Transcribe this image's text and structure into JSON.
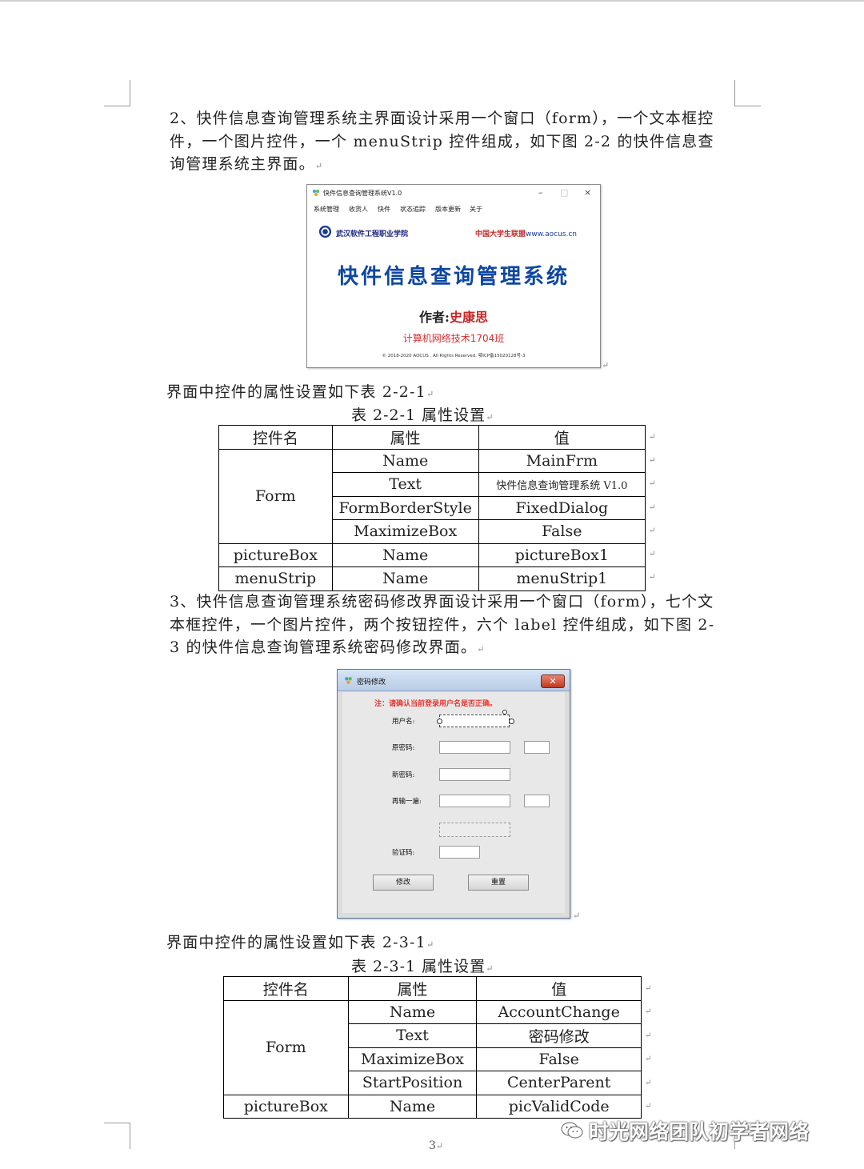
{
  "paragraphs": {
    "p1_line1": "2、快件信息查询管理系统主界面设计采用一个窗口（form），一个文本框控",
    "p1_line2": "件，一个图片控件，一个 menuStrip 控件组成，如下图 2-2 的快件信息查",
    "p1_line3": "询管理系统主界面。",
    "p2": "界面中控件的属性设置如下表 2-2-1",
    "p3_line1": "3、快件信息查询管理系统密码修改界面设计采用一个窗口（form），七个文",
    "p3_line2": "本框控件，一个图片控件，两个按钮控件，六个 label 控件组成，如下图 2-",
    "p3_line3": "3 的快件信息查询管理系统密码修改界面。",
    "p4": "界面中控件的属性设置如下表 2-3-1"
  },
  "table1": {
    "caption": "表 2-2-1  属性设置",
    "headers": [
      "控件名",
      "属性",
      "值"
    ],
    "form_control": "Form",
    "form_rows": [
      {
        "prop": "Name",
        "value": "MainFrm"
      },
      {
        "prop": "Text",
        "value": "快件信息查询管理系统 V1.0"
      },
      {
        "prop": "FormBorderStyle",
        "value": "FixedDialog"
      },
      {
        "prop": "MaximizeBox",
        "value": "False"
      }
    ],
    "other_rows": [
      {
        "control": "pictureBox",
        "prop": "Name",
        "value": "pictureBox1"
      },
      {
        "control": "menuStrip",
        "prop": "Name",
        "value": "menuStrip1"
      }
    ]
  },
  "table2": {
    "caption": "表 2-3-1  属性设置",
    "headers": [
      "控件名",
      "属性",
      "值"
    ],
    "form_control": "Form",
    "form_rows": [
      {
        "prop": "Name",
        "value": "AccountChange"
      },
      {
        "prop": "Text",
        "value": "密码修改"
      },
      {
        "prop": "MaximizeBox",
        "value": "False"
      },
      {
        "prop": "StartPosition",
        "value": "CenterParent"
      }
    ],
    "other_rows": [
      {
        "control": "pictureBox",
        "prop": "Name",
        "value": "picValidCode"
      }
    ]
  },
  "main_window": {
    "title": "快件信息查询管理系统V1.0",
    "menu": [
      "系统管理",
      "收货人",
      "快件",
      "状态追踪",
      "版本更新",
      "关于"
    ],
    "school": "武汉软件工程职业学院",
    "site_cn": "中国大学生联盟",
    "site_url": "www.aocus.cn",
    "system_name": "快件信息查询管理系统",
    "author_label": "作者:",
    "author_name": "史康思",
    "class_name": "计算机网络技术1704班",
    "copyright": "© 2018-2020 AOCUS . All Rights Reserved. 鄂ICP备15020128号-3"
  },
  "password_dialog": {
    "title": "密码修改",
    "note": "注：请确认当前登录用户名是否正确。",
    "labels": {
      "username": "用户名:",
      "old_password": "原密码:",
      "new_password": "新密码:",
      "repeat": "再输一遍:",
      "captcha": "验证码:"
    },
    "buttons": {
      "modify": "修改",
      "reset": "重置"
    }
  },
  "page_number": "3",
  "watermark": "时光网络团队初学者网络",
  "colors": {
    "title_blue": "#0d47a1",
    "red_text": "#d32f2f",
    "dialog_bg": "#e8e8e8"
  }
}
